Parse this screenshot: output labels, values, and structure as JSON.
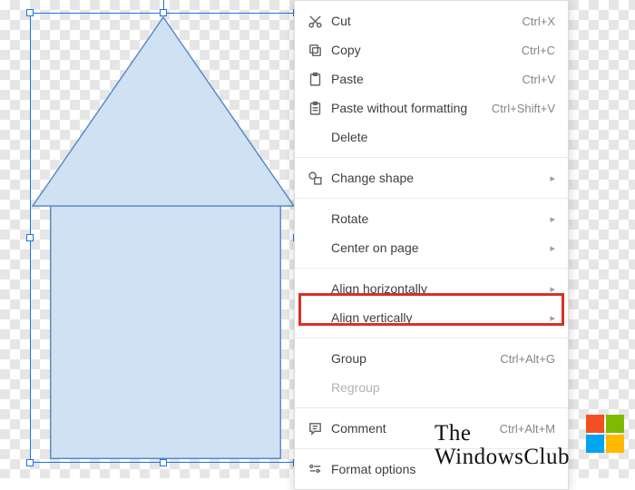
{
  "menu": {
    "cut": {
      "label": "Cut",
      "shortcut": "Ctrl+X"
    },
    "copy": {
      "label": "Copy",
      "shortcut": "Ctrl+C"
    },
    "paste": {
      "label": "Paste",
      "shortcut": "Ctrl+V"
    },
    "paste_wf": {
      "label": "Paste without formatting",
      "shortcut": "Ctrl+Shift+V"
    },
    "delete": {
      "label": "Delete"
    },
    "change_shape": {
      "label": "Change shape"
    },
    "rotate": {
      "label": "Rotate"
    },
    "center": {
      "label": "Center on page"
    },
    "align_h": {
      "label": "Align horizontally"
    },
    "align_v": {
      "label": "Align vertically"
    },
    "group": {
      "label": "Group",
      "shortcut": "Ctrl+Alt+G"
    },
    "regroup": {
      "label": "Regroup"
    },
    "comment": {
      "label": "Comment",
      "shortcut": "Ctrl+Alt+M"
    },
    "format": {
      "label": "Format options"
    }
  },
  "submenu_arrow": "▸",
  "watermark": {
    "line1": "The",
    "line2": "WindowsClub"
  },
  "shapes": {
    "triangle_fill": "#cfe2f3",
    "triangle_stroke": "#5b8bc9",
    "rectangle_fill": "#cfe2f3",
    "rectangle_stroke": "#5b8bc9"
  },
  "highlight_color": "#d93025"
}
